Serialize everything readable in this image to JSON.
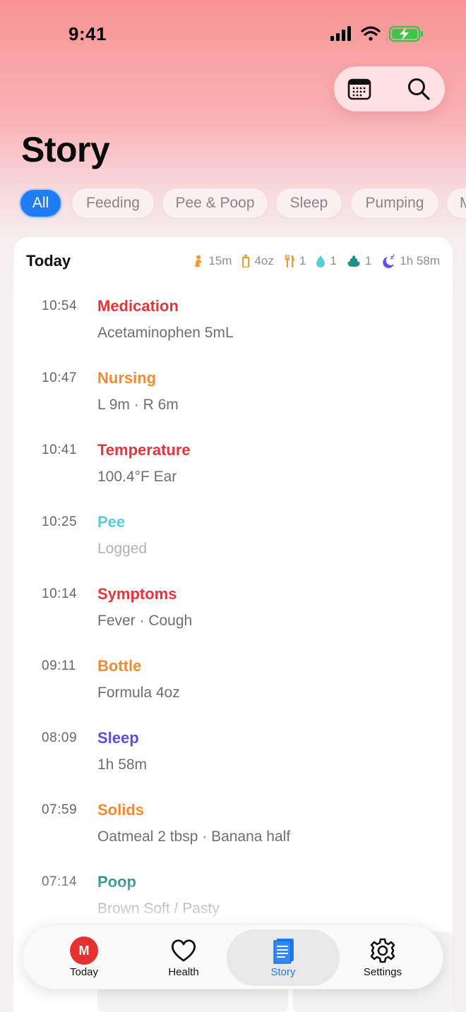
{
  "status_bar": {
    "time": "9:41"
  },
  "page": {
    "title": "Story"
  },
  "filters": [
    {
      "label": "All",
      "active": true
    },
    {
      "label": "Feeding",
      "active": false
    },
    {
      "label": "Pee & Poop",
      "active": false
    },
    {
      "label": "Sleep",
      "active": false
    },
    {
      "label": "Pumping",
      "active": false
    },
    {
      "label": "M",
      "active": false
    }
  ],
  "day": {
    "title": "Today",
    "summary": {
      "nursing": {
        "icon": "nursing-icon",
        "value": "15m"
      },
      "bottle": {
        "icon": "bottle-icon",
        "value": "4oz"
      },
      "solids": {
        "icon": "utensils-icon",
        "value": "1"
      },
      "pee": {
        "icon": "droplet-icon",
        "value": "1"
      },
      "poop": {
        "icon": "poop-icon",
        "value": "1"
      },
      "sleep": {
        "icon": "moon-icon",
        "value": "1h 58m"
      }
    },
    "entries": [
      {
        "time": "10:54",
        "type": "Medication",
        "detail": "Acetaminophen 5mL",
        "color": "#e6353a"
      },
      {
        "time": "10:47",
        "type": "Nursing",
        "detail": "L 9m · R 6m",
        "color": "#f28a2e"
      },
      {
        "time": "10:41",
        "type": "Temperature",
        "detail": "100.4°F Ear",
        "color": "#e6353a"
      },
      {
        "time": "10:25",
        "type": "Pee",
        "detail": "Logged",
        "color": "#5ccbd8",
        "detail_color": "#b3b3b3"
      },
      {
        "time": "10:14",
        "type": "Symptoms",
        "detail": "Fever · Cough",
        "color": "#e6353a"
      },
      {
        "time": "09:11",
        "type": "Bottle",
        "detail": "Formula 4oz",
        "color": "#f28a2e"
      },
      {
        "time": "08:09",
        "type": "Sleep",
        "detail": "1h 58m",
        "color": "#5a4fe0"
      },
      {
        "time": "07:59",
        "type": "Solids",
        "detail": "Oatmeal 2 tbsp · Banana half",
        "color": "#f28a2e"
      },
      {
        "time": "07:14",
        "type": "Poop",
        "detail": "Brown Soft / Pasty",
        "color": "#1f8f8a"
      }
    ]
  },
  "tabbar": {
    "today": {
      "label": "Today",
      "avatar_initial": "M"
    },
    "health": {
      "label": "Health"
    },
    "story": {
      "label": "Story"
    },
    "settings": {
      "label": "Settings"
    }
  },
  "colors": {
    "accent": "#1f7cf2",
    "header_gradient_top": "#f99494"
  }
}
